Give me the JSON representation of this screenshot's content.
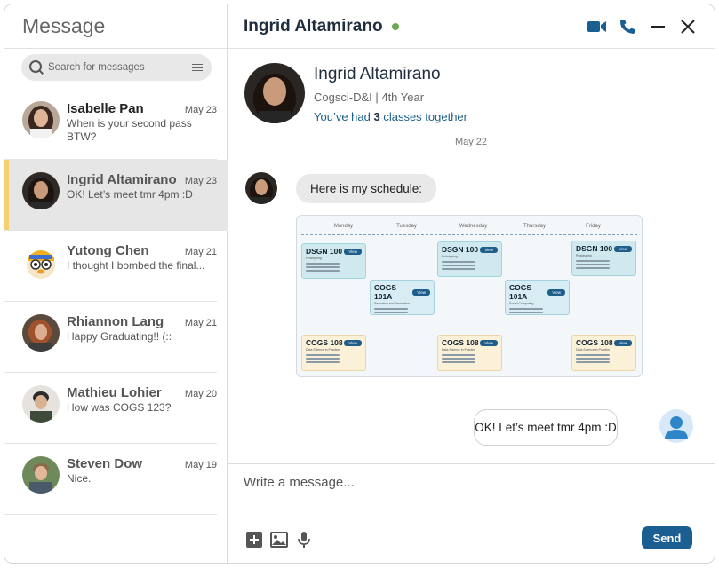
{
  "sidebar": {
    "title": "Message",
    "search": {
      "placeholder": "Search for messages",
      "icon": "search-icon",
      "menu_icon": "menu-icon"
    },
    "conversations": [
      {
        "name": "Isabelle Pan",
        "date": "May 23",
        "preview": "When is your second pass BTW?",
        "unread": true,
        "active": false
      },
      {
        "name": "Ingrid Altamirano",
        "date": "May 23",
        "preview": "OK! Let’s meet tmr 4pm :D",
        "unread": false,
        "active": true
      },
      {
        "name": "Yutong Chen",
        "date": "May 21",
        "preview": "I thought I bombed the final...",
        "unread": false,
        "active": false
      },
      {
        "name": "Rhiannon Lang",
        "date": "May 21",
        "preview": "Happy Graduating!! (::",
        "unread": false,
        "active": false
      },
      {
        "name": "Mathieu Lohier",
        "date": "May 20",
        "preview": "How was COGS 123?",
        "unread": false,
        "active": false
      },
      {
        "name": "Steven Dow",
        "date": "May 19",
        "preview": "Nice.",
        "unread": false,
        "active": false
      }
    ]
  },
  "chat": {
    "header": {
      "name": "Ingrid Altamirano",
      "status": "online",
      "status_color": "#6aa84f",
      "actions": [
        "video-icon",
        "phone-icon",
        "minimize-icon",
        "close-icon"
      ]
    },
    "profile": {
      "name": "Ingrid Altamirano",
      "meta": "Cogsci-D&I | 4th Year",
      "note_prefix": "You’ve had ",
      "note_count": "3",
      "note_suffix": " classes together"
    },
    "date_separator": "May 22",
    "messages": [
      {
        "from": "Ingrid Altamirano",
        "text": "Here is my schedule:"
      },
      {
        "from": "me",
        "text": "OK! Let’s meet tmr 4pm :D"
      }
    ],
    "schedule": {
      "days": [
        "Monday",
        "Tuesday",
        "Wednesday",
        "Thursday",
        "Friday"
      ],
      "view_label": "View",
      "courses": [
        {
          "code": "DSGN 100",
          "sub": "Prototyping",
          "day": "Monday"
        },
        {
          "code": "DSGN 100",
          "sub": "Prototyping",
          "day": "Wednesday"
        },
        {
          "code": "DSGN 100",
          "sub": "Prototyping",
          "day": "Friday"
        },
        {
          "code": "COGS 101A",
          "sub": "Sensation and Perception",
          "day": "Tuesday"
        },
        {
          "code": "COGS 101A",
          "sub": "Social Computing",
          "day": "Thursday"
        },
        {
          "code": "COGS 108",
          "sub": "Data Science in Practice",
          "day": "Monday"
        },
        {
          "code": "COGS 108",
          "sub": "Data Science in Practice",
          "day": "Wednesday"
        },
        {
          "code": "COGS 108",
          "sub": "Data Science in Practice",
          "day": "Friday"
        }
      ]
    },
    "composer": {
      "placeholder": "Write a message...",
      "send_label": "Send",
      "tools": [
        "add-icon",
        "image-icon",
        "microphone-icon"
      ]
    }
  },
  "colors": {
    "accent": "#1b5f92",
    "active_marker": "#f5cf72",
    "link": "#1a5f8a"
  }
}
